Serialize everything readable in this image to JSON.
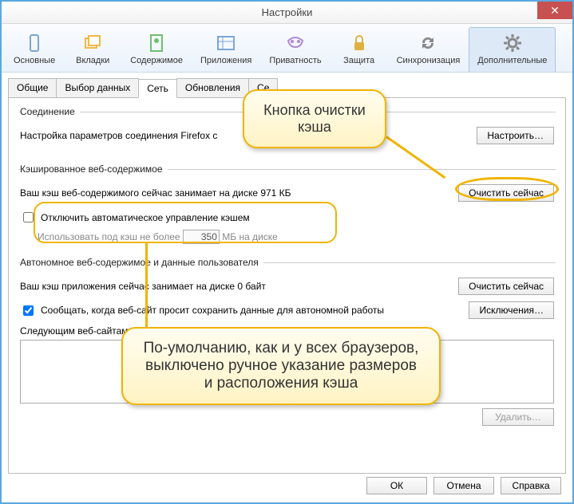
{
  "window": {
    "title": "Настройки",
    "close_glyph": "✕"
  },
  "toolbar": [
    {
      "name": "main",
      "label": "Основные",
      "color": "#7aa6d6"
    },
    {
      "name": "tabs",
      "label": "Вкладки",
      "color": "#f0b848"
    },
    {
      "name": "content",
      "label": "Содержимое",
      "color": "#6fbf6f"
    },
    {
      "name": "apps",
      "label": "Приложения",
      "color": "#7aa6d6"
    },
    {
      "name": "privacy",
      "label": "Приватность",
      "color": "#b088d8"
    },
    {
      "name": "security",
      "label": "Защита",
      "color": "#e0b040"
    },
    {
      "name": "sync",
      "label": "Синхронизация",
      "color": "#888888"
    },
    {
      "name": "advanced",
      "label": "Дополнительные",
      "color": "#888888",
      "active": true
    }
  ],
  "subtabs": [
    {
      "name": "general",
      "label": "Общие"
    },
    {
      "name": "data",
      "label": "Выбор данных"
    },
    {
      "name": "network",
      "label": "Сеть",
      "active": true
    },
    {
      "name": "updates",
      "label": "Обновления"
    },
    {
      "name": "cert",
      "label": "Се"
    }
  ],
  "connection": {
    "legend": "Соединение",
    "text": "Настройка параметров соединения Firefox с",
    "configure_btn": "Настроить…"
  },
  "cache": {
    "legend": "Кэшированное веб-содержимое",
    "status": "Ваш кэш веб-содержимого сейчас занимает на диске 971 КБ",
    "clear_btn": "Очистить сейчас",
    "checkbox_label": "Отключить автоматическое управление кэшем",
    "limit_prefix": "Использовать под кэш не более",
    "limit_value": "350",
    "limit_suffix": "МБ на диске"
  },
  "offline": {
    "legend": "Автономное веб-содержимое и данные пользователя",
    "status": "Ваш кэш приложения сейчас занимает на диске 0 байт",
    "clear_btn": "Очистить сейчас",
    "notify_label": "Сообщать, когда веб-сайт просит сохранить данные для автономной работы",
    "exceptions_btn": "Исключения…",
    "list_label": "Следующим веб-сайтам",
    "delete_btn": "Удалить…"
  },
  "dialog_buttons": {
    "ok": "ОК",
    "cancel": "Отмена",
    "help": "Справка"
  },
  "callouts": {
    "top": "Кнопка очистки кэша",
    "bottom": "По-умолчанию, как и у всех браузеров, выключено ручное указание размеров и расположения кэша"
  }
}
